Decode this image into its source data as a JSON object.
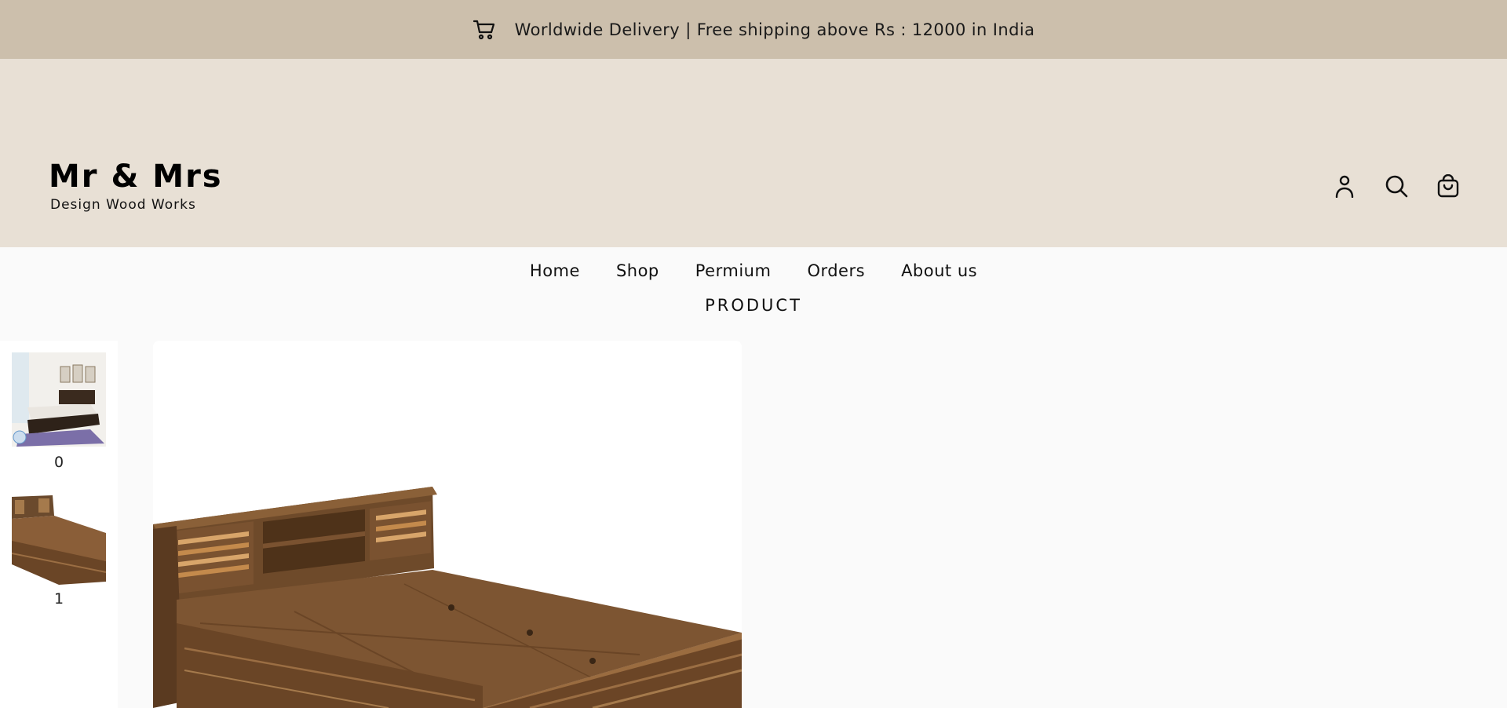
{
  "announcement": {
    "text": "Worldwide Delivery | Free shipping above Rs : 12000 in India",
    "icon": "cart-icon"
  },
  "header": {
    "logo": {
      "brand": "Mr & Mrs",
      "tagline": "Design Wood Works"
    },
    "icons": [
      "account-icon",
      "search-icon",
      "bag-icon"
    ]
  },
  "nav": {
    "items": [
      "Home",
      "Shop",
      "Permium",
      "Orders",
      "About us"
    ]
  },
  "page": {
    "title": "PRODUCT"
  },
  "gallery": {
    "thumbnails": [
      {
        "label": "0"
      },
      {
        "label": "1"
      }
    ]
  },
  "colors": {
    "announce_bg": "#ccbfac",
    "header_bg": "#e8e0d5",
    "page_bg": "#fafafa",
    "wood": "#7a5230"
  }
}
